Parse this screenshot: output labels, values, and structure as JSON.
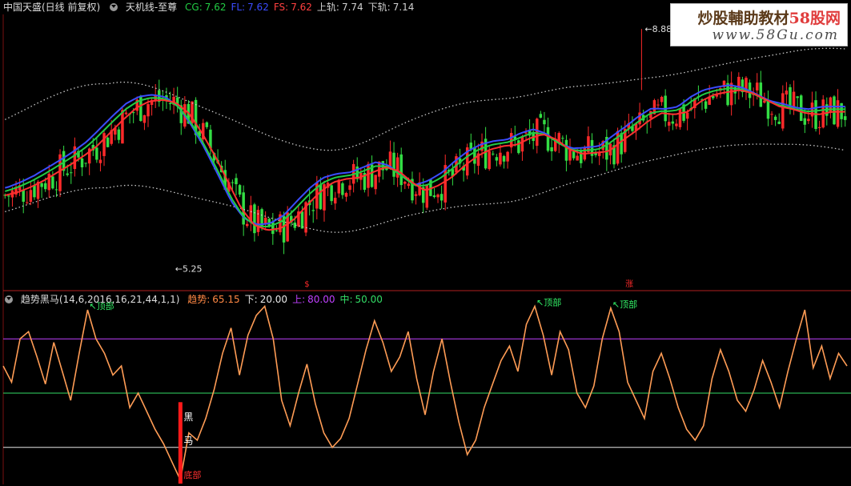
{
  "panel_top": {
    "stock_name": "中国天盛(日线 前复权)",
    "indicator_name": "天机线-至尊",
    "readouts": [
      {
        "label": "CG:",
        "value": "7.62",
        "color": "#22cc44"
      },
      {
        "label": "FL:",
        "value": "7.62",
        "color": "#3b4cff"
      },
      {
        "label": "FS:",
        "value": "7.62",
        "color": "#ff4040"
      },
      {
        "label": "上轨:",
        "value": "7.74",
        "color": "#cfcfcf"
      },
      {
        "label": "下轨:",
        "value": "7.14",
        "color": "#cfcfcf"
      }
    ],
    "high_marker": "8.88",
    "low_marker": "5.25",
    "signal_marks": [
      "$",
      "涨"
    ]
  },
  "panel_bottom": {
    "indicator_name": "趋势黑马(14,6,2016,16,21,44,1,1)",
    "readouts": [
      {
        "label": "趋势:",
        "value": "65.15",
        "color": "#ff8844"
      },
      {
        "label": "下:",
        "value": "20.00",
        "color": "#e8e8e8"
      },
      {
        "label": "上:",
        "value": "80.00",
        "color": "#c040ff"
      },
      {
        "label": "中:",
        "value": "50.00",
        "color": "#33dd66"
      }
    ],
    "top_labels": [
      "顶部",
      "顶部",
      "顶部"
    ],
    "bottom_label": "底部",
    "signal_chars": [
      "黑",
      "马"
    ]
  },
  "watermark": {
    "title": "炒股輔助教材",
    "title_red": "58股网",
    "url": "www.58Gu.com"
  },
  "colors": {
    "up": "#ff2a2a",
    "down": "#33dd44",
    "cg": "#22cc44",
    "fl": "#3b4cff",
    "fs": "#ff3030",
    "band": "#c8c8c8",
    "trend": "#ff9c55",
    "upper_line": "#c040ff",
    "mid_line": "#33dd66",
    "lower_line": "#e8e8e8"
  },
  "chart_data": [
    {
      "type": "candlestick",
      "title": "天机线-至尊",
      "y_range": [
        5.0,
        9.1
      ],
      "candles": [],
      "series": [
        {
          "name": "CG",
          "values": []
        },
        {
          "name": "FL",
          "values": []
        },
        {
          "name": "FS",
          "values": [
            6.35,
            6.4,
            6.48,
            6.58,
            6.7,
            6.82,
            6.95,
            7.1,
            7.3,
            7.5,
            7.68,
            7.78,
            7.8,
            7.76,
            7.6,
            7.3,
            6.95,
            6.55,
            6.15,
            5.9,
            5.82,
            5.85,
            5.98,
            6.2,
            6.4,
            6.55,
            6.6,
            6.62,
            6.7,
            6.78,
            6.72,
            6.55,
            6.42,
            6.5,
            6.62,
            6.8,
            6.95,
            7.05,
            7.1,
            7.12,
            7.22,
            7.28,
            7.2,
            7.05,
            6.98,
            7.0,
            7.02,
            7.18,
            7.32,
            7.48,
            7.6,
            7.58,
            7.62,
            7.78,
            7.88,
            7.92,
            7.95,
            7.9,
            7.8,
            7.7,
            7.66,
            7.6,
            7.58,
            7.62,
            7.62
          ]
        },
        {
          "name": "上轨",
          "values": []
        },
        {
          "name": "下轨",
          "values": []
        }
      ],
      "annotations": [
        {
          "text": "8.88"
        },
        {
          "text": "5.25"
        }
      ]
    },
    {
      "type": "line",
      "title": "趋势黑马(14,6,2016,16,21,44,1,1)",
      "ylim": [
        0,
        100
      ],
      "series": [
        {
          "name": "趋势",
          "values": [
            65,
            56,
            80,
            84,
            70,
            55,
            78,
            62,
            46,
            72,
            96,
            80,
            72,
            60,
            65,
            42,
            50,
            40,
            30,
            22,
            12,
            2,
            28,
            24,
            36,
            52,
            72,
            86,
            60,
            82,
            93,
            98,
            80,
            46,
            32,
            50,
            66,
            44,
            28,
            20,
            25,
            36,
            55,
            74,
            90,
            78,
            62,
            70,
            84,
            58,
            38,
            62,
            80,
            56,
            34,
            16,
            24,
            42,
            55,
            68,
            76,
            62,
            88,
            98,
            82,
            60,
            84,
            74,
            50,
            42,
            54,
            80,
            97,
            84,
            56,
            46,
            36,
            62,
            72,
            58,
            42,
            30,
            24,
            32,
            58,
            74,
            62,
            46,
            40,
            52,
            68,
            56,
            42,
            62,
            80,
            96,
            64,
            76,
            58,
            72,
            65
          ]
        },
        {
          "name": "上",
          "values": [
            80
          ]
        },
        {
          "name": "中",
          "values": [
            50
          ]
        },
        {
          "name": "下",
          "values": [
            20
          ]
        }
      ]
    }
  ]
}
